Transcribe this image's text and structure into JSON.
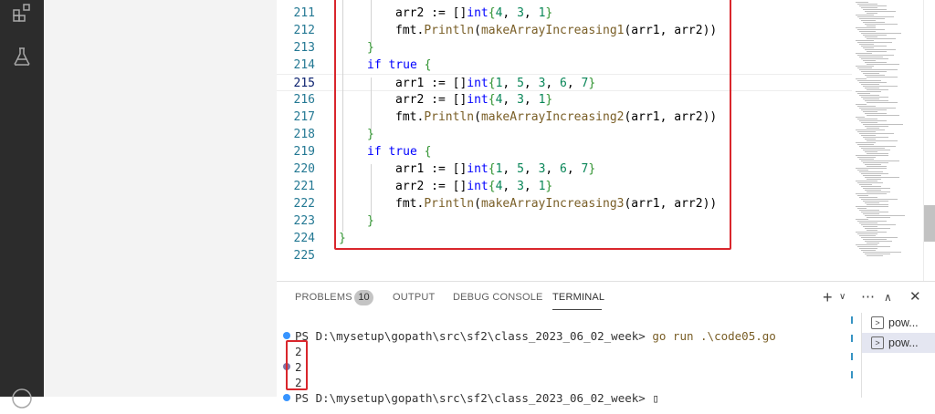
{
  "code_lines": [
    {
      "num": "211",
      "indent": 2,
      "tokens": [
        {
          "t": "arr2 := []",
          "c": ""
        },
        {
          "t": "int",
          "c": "kw"
        },
        {
          "t": "{",
          "c": "br"
        },
        {
          "t": "4",
          "c": "num"
        },
        {
          "t": ", ",
          "c": ""
        },
        {
          "t": "3",
          "c": "num"
        },
        {
          "t": ", ",
          "c": ""
        },
        {
          "t": "1",
          "c": "num"
        },
        {
          "t": "}",
          "c": "br"
        }
      ]
    },
    {
      "num": "212",
      "indent": 2,
      "tokens": [
        {
          "t": "fmt.",
          "c": ""
        },
        {
          "t": "Println",
          "c": "fn"
        },
        {
          "t": "(",
          "c": ""
        },
        {
          "t": "makeArrayIncreasing1",
          "c": "fn"
        },
        {
          "t": "(arr1, arr2))",
          "c": ""
        }
      ]
    },
    {
      "num": "213",
      "indent": 1,
      "tokens": [
        {
          "t": "}",
          "c": "br"
        }
      ]
    },
    {
      "num": "214",
      "indent": 1,
      "tokens": [
        {
          "t": "if",
          "c": "kw"
        },
        {
          "t": " ",
          "c": ""
        },
        {
          "t": "true",
          "c": "kw"
        },
        {
          "t": " ",
          "c": ""
        },
        {
          "t": "{",
          "c": "br"
        }
      ]
    },
    {
      "num": "215",
      "indent": 2,
      "current": true,
      "tokens": [
        {
          "t": "arr1 := []",
          "c": ""
        },
        {
          "t": "int",
          "c": "kw"
        },
        {
          "t": "{",
          "c": "br"
        },
        {
          "t": "1",
          "c": "num"
        },
        {
          "t": ", ",
          "c": ""
        },
        {
          "t": "5",
          "c": "num"
        },
        {
          "t": ", ",
          "c": ""
        },
        {
          "t": "3",
          "c": "num"
        },
        {
          "t": ", ",
          "c": ""
        },
        {
          "t": "6",
          "c": "num"
        },
        {
          "t": ", ",
          "c": ""
        },
        {
          "t": "7",
          "c": "num"
        },
        {
          "t": "}",
          "c": "br"
        }
      ]
    },
    {
      "num": "216",
      "indent": 2,
      "tokens": [
        {
          "t": "arr2 := []",
          "c": ""
        },
        {
          "t": "int",
          "c": "kw"
        },
        {
          "t": "{",
          "c": "br"
        },
        {
          "t": "4",
          "c": "num"
        },
        {
          "t": ", ",
          "c": ""
        },
        {
          "t": "3",
          "c": "num"
        },
        {
          "t": ", ",
          "c": ""
        },
        {
          "t": "1",
          "c": "num"
        },
        {
          "t": "}",
          "c": "br"
        }
      ]
    },
    {
      "num": "217",
      "indent": 2,
      "tokens": [
        {
          "t": "fmt.",
          "c": ""
        },
        {
          "t": "Println",
          "c": "fn"
        },
        {
          "t": "(",
          "c": ""
        },
        {
          "t": "makeArrayIncreasing2",
          "c": "fn"
        },
        {
          "t": "(arr1, arr2))",
          "c": ""
        }
      ]
    },
    {
      "num": "218",
      "indent": 1,
      "tokens": [
        {
          "t": "}",
          "c": "br"
        }
      ]
    },
    {
      "num": "219",
      "indent": 1,
      "tokens": [
        {
          "t": "if",
          "c": "kw"
        },
        {
          "t": " ",
          "c": ""
        },
        {
          "t": "true",
          "c": "kw"
        },
        {
          "t": " ",
          "c": ""
        },
        {
          "t": "{",
          "c": "br"
        }
      ]
    },
    {
      "num": "220",
      "indent": 2,
      "tokens": [
        {
          "t": "arr1 := []",
          "c": ""
        },
        {
          "t": "int",
          "c": "kw"
        },
        {
          "t": "{",
          "c": "br"
        },
        {
          "t": "1",
          "c": "num"
        },
        {
          "t": ", ",
          "c": ""
        },
        {
          "t": "5",
          "c": "num"
        },
        {
          "t": ", ",
          "c": ""
        },
        {
          "t": "3",
          "c": "num"
        },
        {
          "t": ", ",
          "c": ""
        },
        {
          "t": "6",
          "c": "num"
        },
        {
          "t": ", ",
          "c": ""
        },
        {
          "t": "7",
          "c": "num"
        },
        {
          "t": "}",
          "c": "br"
        }
      ]
    },
    {
      "num": "221",
      "indent": 2,
      "tokens": [
        {
          "t": "arr2 := []",
          "c": ""
        },
        {
          "t": "int",
          "c": "kw"
        },
        {
          "t": "{",
          "c": "br"
        },
        {
          "t": "4",
          "c": "num"
        },
        {
          "t": ", ",
          "c": ""
        },
        {
          "t": "3",
          "c": "num"
        },
        {
          "t": ", ",
          "c": ""
        },
        {
          "t": "1",
          "c": "num"
        },
        {
          "t": "}",
          "c": "br"
        }
      ]
    },
    {
      "num": "222",
      "indent": 2,
      "tokens": [
        {
          "t": "fmt.",
          "c": ""
        },
        {
          "t": "Println",
          "c": "fn"
        },
        {
          "t": "(",
          "c": ""
        },
        {
          "t": "makeArrayIncreasing3",
          "c": "fn"
        },
        {
          "t": "(arr1, arr2))",
          "c": ""
        }
      ]
    },
    {
      "num": "223",
      "indent": 1,
      "tokens": [
        {
          "t": "}",
          "c": "br"
        }
      ]
    },
    {
      "num": "224",
      "indent": 0,
      "tokens": [
        {
          "t": "}",
          "c": "br"
        }
      ]
    },
    {
      "num": "225",
      "indent": 0,
      "tokens": []
    }
  ],
  "panel": {
    "tabs": [
      {
        "label": "PROBLEMS",
        "name": "tab-problems"
      },
      {
        "label": "OUTPUT",
        "name": "tab-output"
      },
      {
        "label": "DEBUG CONSOLE",
        "name": "tab-debug-console"
      },
      {
        "label": "TERMINAL",
        "name": "tab-terminal",
        "active": true
      }
    ],
    "problems_count": "10",
    "icons": {
      "new_terminal": "plus-icon",
      "dropdown": "chevron-down-icon",
      "more": "ellipsis-icon",
      "maximize": "chevron-up-icon",
      "close": "close-icon"
    }
  },
  "terminal": {
    "prompt": "PS D:\\mysetup\\gopath\\src\\sf2\\class_2023_06_02_week>",
    "command": "go run .\\code05.go",
    "output": [
      "2",
      "2",
      "2"
    ],
    "cursor": "▯",
    "list": [
      {
        "label": "pow..."
      },
      {
        "label": "pow...",
        "selected": true
      }
    ]
  },
  "colors": {
    "highlight": "#d9262c",
    "dot_blue": "#3794ff",
    "dot_purple": "#7f74a6"
  }
}
